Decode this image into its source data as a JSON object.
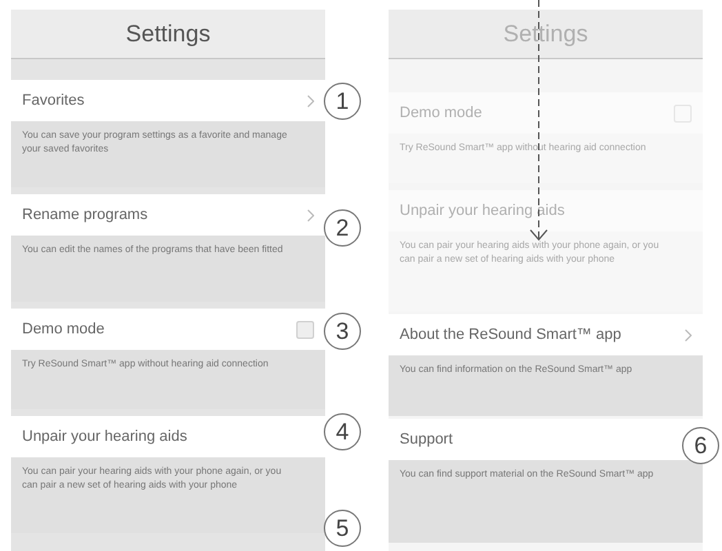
{
  "screens": [
    {
      "title": "Settings",
      "dimmed": false,
      "items": [
        {
          "kind": "link",
          "title": "Favorites",
          "description": "You can save your program settings as a favorite and manage your saved favorites",
          "dimmed": false
        },
        {
          "kind": "link",
          "title": "Rename programs",
          "description": "You can edit the names of the programs that have been fitted",
          "dimmed": false
        },
        {
          "kind": "toggle",
          "title": "Demo mode",
          "checked": false,
          "description": "Try ReSound Smart™ app without hearing aid connection",
          "dimmed": false
        },
        {
          "kind": "plain",
          "title": "Unpair your hearing aids",
          "description": "You can pair your hearing aids with your phone again, or you can pair a new set of hearing aids with your phone",
          "dimmed": false
        }
      ]
    },
    {
      "title": "Settings",
      "dimmed": true,
      "items": [
        {
          "kind": "toggle",
          "title": "Demo mode",
          "checked": false,
          "description": "Try ReSound Smart™ app without hearing aid connection",
          "dimmed": true
        },
        {
          "kind": "plain",
          "title": "Unpair your hearing aids",
          "description": "You can pair your hearing aids with your phone again, or you can pair a new set of hearing aids with your phone",
          "dimmed": true
        },
        {
          "kind": "link",
          "title": "About the ReSound Smart™ app",
          "description": "You can find information on the ReSound Smart™ app",
          "dimmed": false
        },
        {
          "kind": "plain",
          "title": "Support",
          "description": "You can find support material on the ReSound Smart™ app",
          "dimmed": false
        }
      ]
    }
  ],
  "callouts": [
    "1",
    "2",
    "3",
    "4",
    "5",
    "6"
  ]
}
